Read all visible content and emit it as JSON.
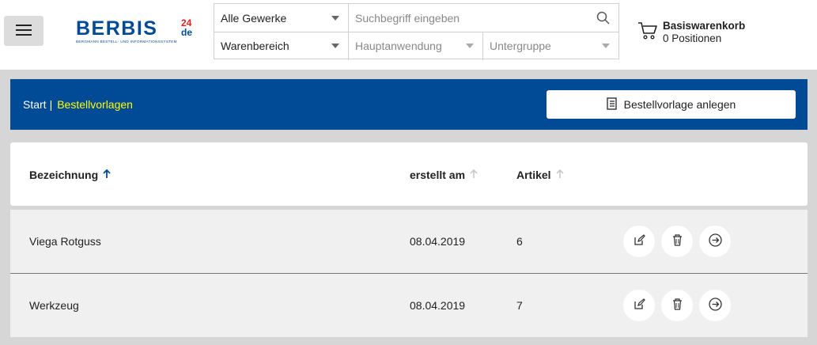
{
  "header": {
    "logo_text": "BERBIS",
    "logo_badge_top": "24",
    "logo_badge_bottom": "de",
    "logo_tagline": "BERGMANN BESTELL- UND INFORMATIONSSYSTEM",
    "search": {
      "trade_select": "Alle Gewerke",
      "search_placeholder": "Suchbegriff eingeben",
      "area_select": "Warenbereich",
      "main_application_select": "Hauptanwendung",
      "subgroup_select": "Untergruppe"
    },
    "cart": {
      "title": "Basiswarenkorb",
      "count": "0 Positionen"
    }
  },
  "breadcrumb": {
    "start": "Start",
    "separator": "|",
    "current": "Bestellvorlagen"
  },
  "create_button_label": "Bestellvorlage anlegen",
  "table": {
    "columns": {
      "name": "Bezeichnung",
      "created": "erstellt am",
      "articles": "Artikel"
    },
    "rows": [
      {
        "name": "Viega Rotguss",
        "created": "08.04.2019",
        "articles": "6"
      },
      {
        "name": "Werkzeug",
        "created": "08.04.2019",
        "articles": "7"
      }
    ]
  },
  "colors": {
    "brand_blue": "#004a96",
    "highlight": "#ffff00",
    "logo_red": "#e2231a"
  },
  "icons": {
    "menu": "hamburger-icon",
    "search": "search-icon",
    "cart": "cart-icon",
    "create": "document-list-icon",
    "sort_active": "arrow-up-icon",
    "sort_inactive": "arrow-up-icon",
    "edit": "edit-icon",
    "delete": "trash-icon",
    "open": "arrow-right-circle-icon"
  }
}
